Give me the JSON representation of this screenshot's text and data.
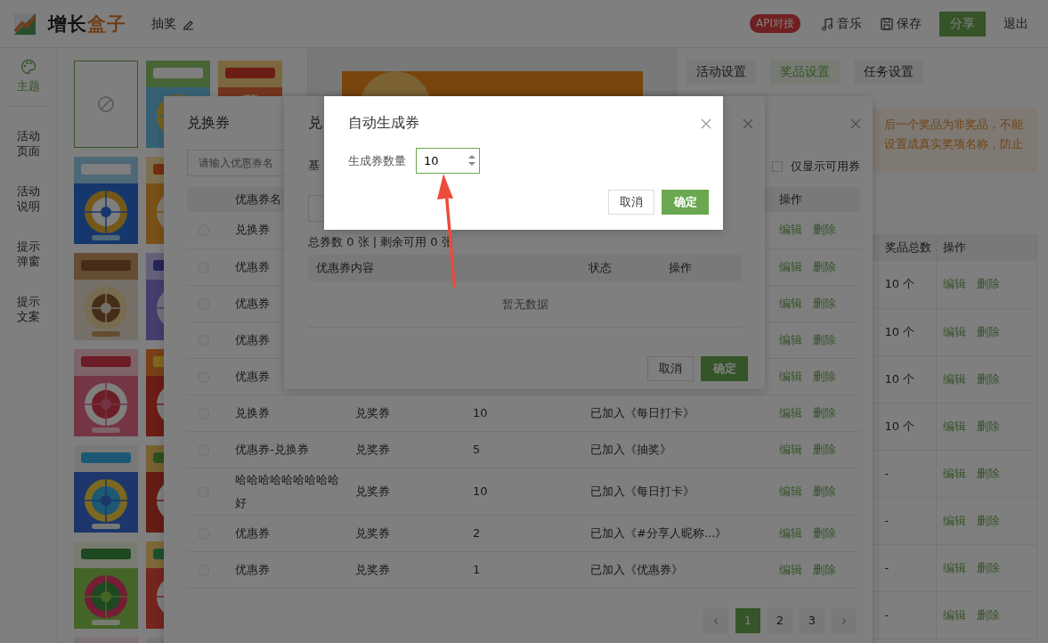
{
  "header": {
    "logo_main": "增长",
    "logo_accent": "盒子",
    "activity_name": "抽奖",
    "api_badge": "API对接",
    "actions": [
      {
        "kind": "music",
        "label": "音乐"
      },
      {
        "kind": "save",
        "label": "保存"
      },
      {
        "kind": "share",
        "label": "分享"
      },
      {
        "kind": "exit",
        "label": "退出"
      }
    ]
  },
  "sidebar": {
    "items": [
      {
        "kind": "theme",
        "label": "主题",
        "selected": true
      },
      {
        "kind": "text",
        "label": "活动页面",
        "selected": false
      },
      {
        "kind": "text",
        "label": "活动说明",
        "selected": false
      },
      {
        "kind": "text",
        "label": "提示弹窗",
        "selected": false
      },
      {
        "kind": "text",
        "label": "提示文案",
        "selected": false
      }
    ]
  },
  "themes": [
    {
      "kind": "none",
      "selected": true
    },
    {
      "kind": "picture",
      "selected": false
    },
    {
      "kind": "picture",
      "selected": false
    },
    {
      "kind": "picture",
      "selected": false
    },
    {
      "kind": "picture",
      "selected": false
    },
    {
      "kind": "picture",
      "selected": false
    },
    {
      "kind": "picture",
      "selected": false
    },
    {
      "kind": "picture",
      "selected": false
    },
    {
      "kind": "picture",
      "selected": false
    },
    {
      "kind": "picture",
      "selected": false
    },
    {
      "kind": "picture",
      "selected": false
    },
    {
      "kind": "picture",
      "selected": false
    },
    {
      "kind": "picture",
      "selected": false
    },
    {
      "kind": "picture",
      "selected": false
    },
    {
      "kind": "picture",
      "selected": false
    }
  ],
  "settings_tabs": [
    {
      "label": "活动设置",
      "selected": false
    },
    {
      "label": "奖品设置",
      "selected": true
    },
    {
      "label": "任务设置",
      "selected": false
    }
  ],
  "notice": [
    "后一个奖品为非奖品，不能",
    "设置成真实奖项名称，防止"
  ],
  "prize_table": {
    "columns": [
      "奖品总数",
      "操作"
    ],
    "rows": [
      {
        "total": "10 个",
        "actions": [
          "编辑",
          "删除"
        ]
      },
      {
        "total": "10 个",
        "actions": [
          "编辑",
          "删除"
        ]
      },
      {
        "total": "10 个",
        "actions": [
          "编辑",
          "删除"
        ]
      },
      {
        "total": "10 个",
        "actions": [
          "编辑",
          "删除"
        ]
      },
      {
        "total": "-",
        "actions": [
          "编辑",
          "删除"
        ]
      },
      {
        "total": "-",
        "actions": [
          "编辑",
          "删除"
        ]
      },
      {
        "total": "-",
        "actions": [
          "编辑",
          "删除"
        ]
      },
      {
        "total": "-",
        "actions": [
          "编辑",
          "删除"
        ]
      }
    ]
  },
  "coupon_dialog": {
    "title": "兑换券",
    "search": {
      "placeholder": "请输入优惠券名"
    },
    "available_only": {
      "label": "仅显示可用券",
      "checked": false
    },
    "columns": [
      "优惠券名",
      "操作"
    ],
    "rows": [
      {
        "name": "兑换券",
        "selected": false,
        "actions": [
          "编辑",
          "删除"
        ]
      },
      {
        "name": "优惠券",
        "selected": false,
        "actions": [
          "编辑",
          "删除"
        ]
      },
      {
        "name": "优惠券",
        "selected": false,
        "actions": [
          "编辑",
          "删除"
        ]
      },
      {
        "name": "优惠券",
        "selected": false,
        "actions": [
          "编辑",
          "删除"
        ]
      },
      {
        "name": "优惠券",
        "selected": false,
        "actions": [
          "编辑",
          "删除"
        ]
      },
      {
        "name": "兑换券",
        "type": "兑奖券",
        "count": "10",
        "status": "已加入《每日打卡》",
        "selected": false,
        "actions": [
          "编辑",
          "删除"
        ]
      },
      {
        "name": "优惠券-兑换券",
        "type": "兑奖券",
        "count": "5",
        "status": "已加入《抽奖》",
        "selected": false,
        "actions": [
          "编辑",
          "删除"
        ]
      },
      {
        "name": "哈哈哈哈哈哈哈哈哈好",
        "type": "兑奖券",
        "count": "10",
        "status": "已加入《每日打卡》",
        "selected": false,
        "actions": [
          "编辑",
          "删除"
        ]
      },
      {
        "name": "优惠券",
        "type": "兑奖券",
        "count": "2",
        "status": "已加入《#分享人昵称...》",
        "selected": false,
        "actions": [
          "编辑",
          "删除"
        ]
      },
      {
        "name": "优惠券",
        "type": "兑奖券",
        "count": "1",
        "status": "已加入《优惠券》",
        "selected": false,
        "actions": [
          "编辑",
          "删除"
        ]
      }
    ],
    "pagination": {
      "prev": "‹",
      "pages": [
        {
          "label": "1",
          "selected": true
        },
        {
          "label": "2",
          "selected": false
        },
        {
          "label": "3",
          "selected": false
        }
      ],
      "next": "›"
    }
  },
  "coupon_detail_dialog": {
    "title": "兑",
    "section_label": "基",
    "summary": "总券数 0 张 | 剩余可用 0 张",
    "columns": [
      "优惠券内容",
      "状态",
      "操作"
    ],
    "empty_text": "暂无数据",
    "buttons": [
      {
        "kind": "secondary",
        "label": "取消"
      },
      {
        "kind": "primary",
        "label": "确定"
      }
    ]
  },
  "generate_dialog": {
    "title": "自动生成券",
    "field": {
      "label": "生成券数量",
      "value": "10"
    },
    "buttons": [
      {
        "kind": "secondary",
        "label": "取消"
      },
      {
        "kind": "primary",
        "label": "确定"
      }
    ]
  }
}
